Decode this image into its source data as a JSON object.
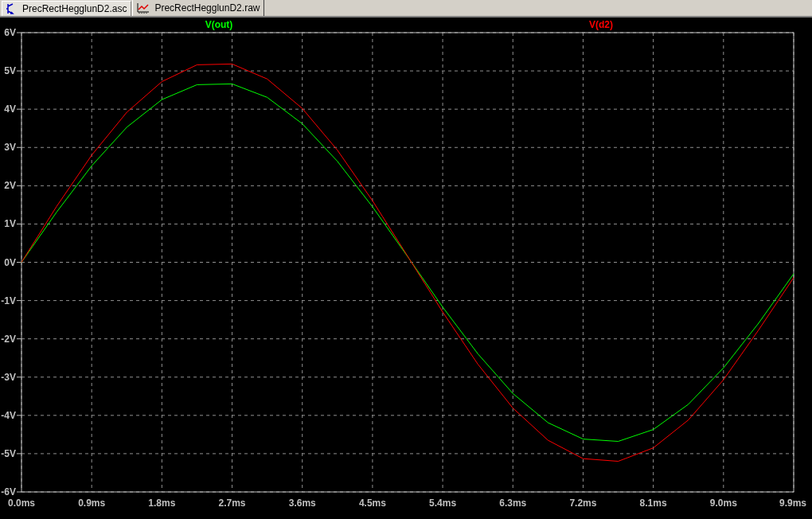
{
  "tabs": [
    {
      "label": "PrecRectHegglunD2.asc",
      "kind": "schematic",
      "selected": false
    },
    {
      "label": "PrecRectHegglunD2.raw",
      "kind": "waveform",
      "selected": true
    }
  ],
  "plot": {
    "chart_data": {
      "type": "line",
      "x": [
        0,
        0.45,
        0.9,
        1.35,
        1.8,
        2.25,
        2.7,
        3.15,
        3.6,
        4.05,
        4.5,
        4.95,
        5.4,
        5.85,
        6.3,
        6.75,
        7.2,
        7.65,
        8.1,
        8.55,
        9.0,
        9.45,
        9.9
      ],
      "series": [
        {
          "name": "V(out)",
          "color": "#00ff00",
          "values": [
            0,
            1.31,
            2.52,
            3.53,
            4.25,
            4.64,
            4.66,
            4.31,
            3.62,
            2.64,
            1.45,
            0.15,
            -1.17,
            -2.39,
            -3.43,
            -4.19,
            -4.62,
            -4.68,
            -4.37,
            -3.71,
            -2.76,
            -1.59,
            -0.3
          ]
        },
        {
          "name": "V(d2)",
          "color": "#ff0000",
          "values": [
            0,
            1.46,
            2.8,
            3.92,
            4.72,
            5.16,
            5.18,
            4.79,
            4.02,
            2.93,
            1.61,
            0.16,
            -1.3,
            -2.66,
            -3.81,
            -4.65,
            -5.13,
            -5.2,
            -4.85,
            -4.12,
            -3.07,
            -1.77,
            -0.4
          ]
        }
      ],
      "xlim": [
        0,
        9.9
      ],
      "ylim": [
        -6,
        6
      ],
      "grid": true,
      "xticks": [
        {
          "value": 0,
          "label": "0.0ms"
        },
        {
          "value": 0.9,
          "label": "0.9ms"
        },
        {
          "value": 1.8,
          "label": "1.8ms"
        },
        {
          "value": 2.7,
          "label": "2.7ms"
        },
        {
          "value": 3.6,
          "label": "3.6ms"
        },
        {
          "value": 4.5,
          "label": "4.5ms"
        },
        {
          "value": 5.4,
          "label": "5.4ms"
        },
        {
          "value": 6.3,
          "label": "6.3ms"
        },
        {
          "value": 7.2,
          "label": "7.2ms"
        },
        {
          "value": 8.1,
          "label": "8.1ms"
        },
        {
          "value": 9.0,
          "label": "9.0ms"
        },
        {
          "value": 9.9,
          "label": "9.9ms"
        }
      ],
      "yticks": [
        {
          "value": 6,
          "label": "6V"
        },
        {
          "value": 5,
          "label": "5V"
        },
        {
          "value": 4,
          "label": "4V"
        },
        {
          "value": 3,
          "label": "3V"
        },
        {
          "value": 2,
          "label": "2V"
        },
        {
          "value": 1,
          "label": "1V"
        },
        {
          "value": 0,
          "label": "0V"
        },
        {
          "value": -1,
          "label": "-1V"
        },
        {
          "value": -2,
          "label": "-2V"
        },
        {
          "value": -3,
          "label": "-3V"
        },
        {
          "value": -4,
          "label": "-4V"
        },
        {
          "value": -5,
          "label": "-5V"
        },
        {
          "value": -6,
          "label": "-6V"
        }
      ]
    }
  }
}
